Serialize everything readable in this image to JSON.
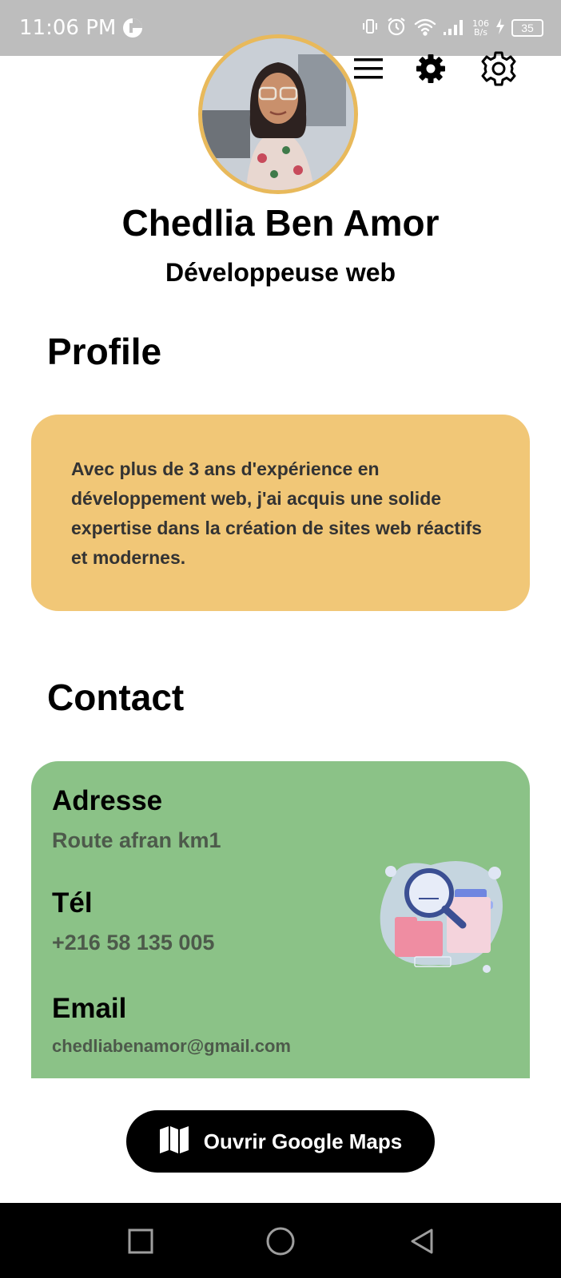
{
  "status_bar": {
    "time": "11:06 PM",
    "net_speed_value": "106",
    "net_speed_unit": "B/s",
    "battery": "35",
    "icons": [
      "data-saver-icon",
      "vibrate-icon",
      "alarm-icon",
      "wifi-icon",
      "signal-icon",
      "charging-icon",
      "battery-icon"
    ]
  },
  "toolbar": {
    "icons": [
      "menu-icon",
      "settings-filled-icon",
      "settings-outline-icon"
    ]
  },
  "profile_header": {
    "name": "Chedlia Ben Amor",
    "job_title": "Développeuse web"
  },
  "profile": {
    "title": "Profile",
    "text": "Avec plus de 3 ans d'expérience en développement web, j'ai acquis une solide expertise dans la création de sites web réactifs et modernes."
  },
  "contact": {
    "title": "Contact",
    "address_label": "Adresse",
    "address_value": "Route afran km1",
    "phone_label": "Tél",
    "phone_value": "+216 58 135 005",
    "email_label": "Email",
    "email_value": "chedliabenamor@gmail.com"
  },
  "maps_button": {
    "label": "Ouvrir Google Maps",
    "icon": "map-icon"
  },
  "nav_bar": {
    "icons": [
      "recents-square-icon",
      "home-circle-icon",
      "back-triangle-icon"
    ]
  },
  "colors": {
    "status_bar": "#bdbdbd",
    "avatar_ring": "#e8b95b",
    "profile_card": "#f1c777",
    "contact_card": "#8bc287",
    "contact_value": "#4d5a4b",
    "button": "#000000"
  }
}
